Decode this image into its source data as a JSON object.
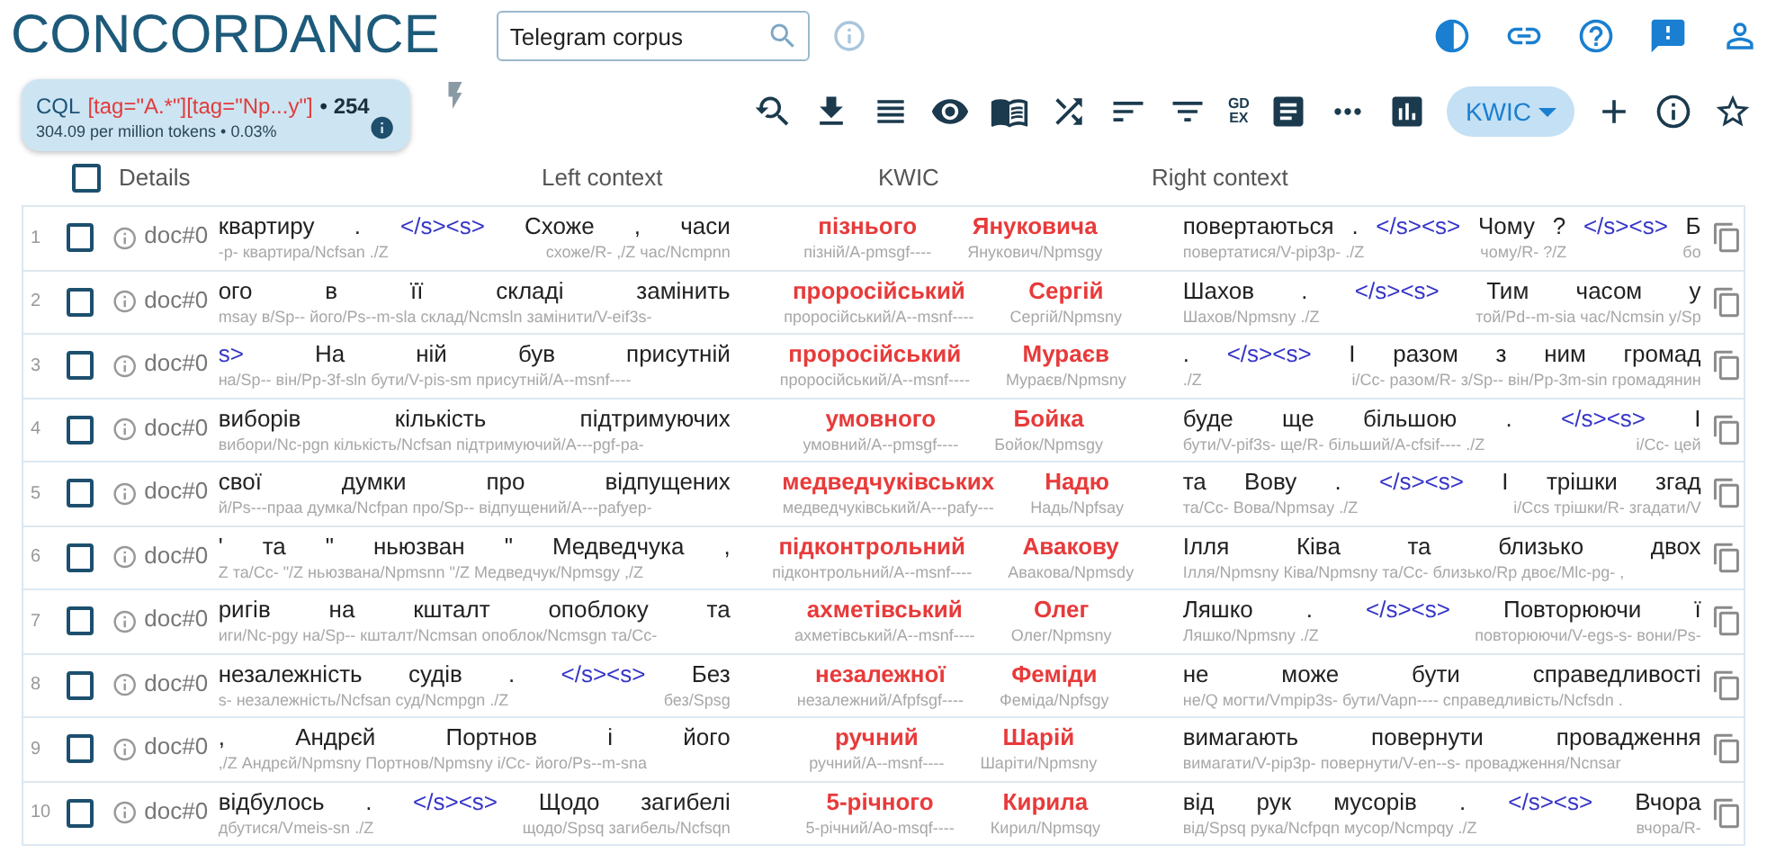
{
  "app_title": "CONCORDANCE",
  "search": {
    "value": "Telegram corpus"
  },
  "query": {
    "label": "CQL",
    "expression": "[tag=\"A.*\"][tag=\"Np...y\"]",
    "count": "• 254",
    "stats": "304.09 per million tokens • 0.03%"
  },
  "toolbar": {
    "gdex": [
      "GD",
      "EX"
    ],
    "view_mode": "KWIC"
  },
  "table": {
    "select_all": {
      "checked": false
    },
    "columns": [
      "Details",
      "Left context",
      "KWIC",
      "Right context"
    ],
    "rows": [
      {
        "number": "1",
        "checked": false,
        "doc": "doc#0",
        "left": {
          "tokens": [
            {
              "kind": "word",
              "text": "квартиру"
            },
            {
              "kind": "word",
              "text": "."
            },
            {
              "kind": "boundary",
              "text": "</s><s>"
            },
            {
              "kind": "word",
              "text": "Схоже"
            },
            {
              "kind": "word",
              "text": ","
            },
            {
              "kind": "word",
              "text": "часи"
            }
          ],
          "tags": [
            "-p- квартира/Ncfsan ./Z",
            "схоже/R- ,/Z час/Ncmpnn"
          ]
        },
        "kwic": [
          {
            "text": "пізнього",
            "tag": "пізній/A-pmsgf----"
          },
          {
            "text": "Януковича",
            "tag": "Янукович/Npmsgy"
          }
        ],
        "right": {
          "tokens": [
            {
              "kind": "word",
              "text": "повертаються"
            },
            {
              "kind": "word",
              "text": "."
            },
            {
              "kind": "boundary",
              "text": "</s><s>"
            },
            {
              "kind": "word",
              "text": "Чому"
            },
            {
              "kind": "word",
              "text": "?"
            },
            {
              "kind": "boundary",
              "text": "</s><s>"
            },
            {
              "kind": "word",
              "text": "Б"
            }
          ],
          "tags": [
            "повертатися/V-pip3p- ./Z",
            "чому/R- ?/Z",
            "бо"
          ]
        }
      },
      {
        "number": "2",
        "checked": false,
        "doc": "doc#0",
        "left": {
          "tokens": [
            {
              "kind": "word",
              "text": "ого"
            },
            {
              "kind": "word",
              "text": "в"
            },
            {
              "kind": "word",
              "text": "її"
            },
            {
              "kind": "word",
              "text": "складі"
            },
            {
              "kind": "word",
              "text": "замінить"
            }
          ],
          "tags": [
            "msay в/Sp-- його/Ps--m-sla склад/Ncmsln замінити/V-eif3s-"
          ]
        },
        "kwic": [
          {
            "text": "проросійський",
            "tag": "проросійський/A--msnf----"
          },
          {
            "text": "Сергій",
            "tag": "Сергій/Npmsny"
          }
        ],
        "right": {
          "tokens": [
            {
              "kind": "word",
              "text": "Шахов"
            },
            {
              "kind": "word",
              "text": "."
            },
            {
              "kind": "boundary",
              "text": "</s><s>"
            },
            {
              "kind": "word",
              "text": "Тим"
            },
            {
              "kind": "word",
              "text": "часом"
            },
            {
              "kind": "word",
              "text": "у"
            }
          ],
          "tags": [
            "Шахов/Npmsny ./Z",
            "той/Pd--m-sia час/Ncmsin у/Sp"
          ]
        }
      },
      {
        "number": "3",
        "checked": false,
        "doc": "doc#0",
        "left": {
          "tokens": [
            {
              "kind": "boundary",
              "text": "s>"
            },
            {
              "kind": "word",
              "text": "На"
            },
            {
              "kind": "word",
              "text": "ній"
            },
            {
              "kind": "word",
              "text": "був"
            },
            {
              "kind": "word",
              "text": "присутній"
            }
          ],
          "tags": [
            "на/Sp-- він/Pp-3f-sln бути/V-pis-sm присутній/A--msnf----"
          ]
        },
        "kwic": [
          {
            "text": "проросійський",
            "tag": "проросійський/A--msnf----"
          },
          {
            "text": "Мураєв",
            "tag": "Мураєв/Npmsny"
          }
        ],
        "right": {
          "tokens": [
            {
              "kind": "word",
              "text": "."
            },
            {
              "kind": "boundary",
              "text": "</s><s>"
            },
            {
              "kind": "word",
              "text": "І"
            },
            {
              "kind": "word",
              "text": "разом"
            },
            {
              "kind": "word",
              "text": "з"
            },
            {
              "kind": "word",
              "text": "ним"
            },
            {
              "kind": "word",
              "text": "громад"
            }
          ],
          "tags": [
            "./Z",
            "і/Cc- разом/R- з/Sp-- він/Pp-3m-sin громадянин"
          ]
        }
      },
      {
        "number": "4",
        "checked": false,
        "doc": "doc#0",
        "left": {
          "tokens": [
            {
              "kind": "word",
              "text": "виборів"
            },
            {
              "kind": "word",
              "text": "кількість"
            },
            {
              "kind": "word",
              "text": "підтримуючих"
            }
          ],
          "tags": [
            "вибори/Nc-pgn кількість/Ncfsan підтримуючий/A---pgf-pa-"
          ]
        },
        "kwic": [
          {
            "text": "умовного",
            "tag": "умовний/A--pmsgf----"
          },
          {
            "text": "Бойка",
            "tag": "Бойок/Npmsgy"
          }
        ],
        "right": {
          "tokens": [
            {
              "kind": "word",
              "text": "буде"
            },
            {
              "kind": "word",
              "text": "ще"
            },
            {
              "kind": "word",
              "text": "більшою"
            },
            {
              "kind": "word",
              "text": "."
            },
            {
              "kind": "boundary",
              "text": "</s><s>"
            },
            {
              "kind": "word",
              "text": "І"
            }
          ],
          "tags": [
            "бути/V-pif3s- ще/R- більший/A-cfsif---- ./Z",
            "і/Cc- цей"
          ]
        }
      },
      {
        "number": "5",
        "checked": false,
        "doc": "doc#0",
        "left": {
          "tokens": [
            {
              "kind": "word",
              "text": "свої"
            },
            {
              "kind": "word",
              "text": "думки"
            },
            {
              "kind": "word",
              "text": "про"
            },
            {
              "kind": "word",
              "text": "відпущених"
            }
          ],
          "tags": [
            "й/Ps---праа думка/Ncfpan про/Sp-- відпущений/A---pafyep-"
          ]
        },
        "kwic": [
          {
            "text": "медведчуківських",
            "tag": "медведчуківський/A---pafy---"
          },
          {
            "text": "Надю",
            "tag": "Надь/Npfsay"
          }
        ],
        "right": {
          "tokens": [
            {
              "kind": "word",
              "text": "та"
            },
            {
              "kind": "word",
              "text": "Вову"
            },
            {
              "kind": "word",
              "text": "."
            },
            {
              "kind": "boundary",
              "text": "</s><s>"
            },
            {
              "kind": "word",
              "text": "І"
            },
            {
              "kind": "word",
              "text": "трішки"
            },
            {
              "kind": "word",
              "text": "згад"
            }
          ],
          "tags": [
            "та/Cc- Вова/Npmsay ./Z",
            "і/Ccs трішки/R- згадати/V"
          ]
        }
      },
      {
        "number": "6",
        "checked": false,
        "doc": "doc#0",
        "left": {
          "tokens": [
            {
              "kind": "word",
              "text": "'"
            },
            {
              "kind": "word",
              "text": "та"
            },
            {
              "kind": "word",
              "text": "\""
            },
            {
              "kind": "word",
              "text": "ньюзван"
            },
            {
              "kind": "word",
              "text": "\""
            },
            {
              "kind": "word",
              "text": "Медведчука"
            },
            {
              "kind": "word",
              "text": ","
            }
          ],
          "tags": [
            "Z та/Cc- \"/Z ньюзвана/Npmsnn \"/Z Медведчук/Npmsgy ,/Z"
          ]
        },
        "kwic": [
          {
            "text": "підконтрольний",
            "tag": "підконтрольний/A--msnf----"
          },
          {
            "text": "Авакову",
            "tag": "Авакова/Npmsdy"
          }
        ],
        "right": {
          "tokens": [
            {
              "kind": "word",
              "text": "Ілля"
            },
            {
              "kind": "word",
              "text": "Ківа"
            },
            {
              "kind": "word",
              "text": "та"
            },
            {
              "kind": "word",
              "text": "близько"
            },
            {
              "kind": "word",
              "text": "двох"
            }
          ],
          "tags": [
            "Ілля/Npmsny Ківа/Npmsny та/Cc- близько/Rp двоє/Mlc-pg- ,"
          ]
        }
      },
      {
        "number": "7",
        "checked": false,
        "doc": "doc#0",
        "left": {
          "tokens": [
            {
              "kind": "word",
              "text": "ригів"
            },
            {
              "kind": "word",
              "text": "на"
            },
            {
              "kind": "word",
              "text": "кшталт"
            },
            {
              "kind": "word",
              "text": "опоблоку"
            },
            {
              "kind": "word",
              "text": "та"
            }
          ],
          "tags": [
            "иги/Nc-pgy на/Sp-- кшталт/Ncmsan опоблок/Ncmsgn та/Cc-"
          ]
        },
        "kwic": [
          {
            "text": "ахметівський",
            "tag": "ахметівський/A--msnf----"
          },
          {
            "text": "Олег",
            "tag": "Олег/Npmsny"
          }
        ],
        "right": {
          "tokens": [
            {
              "kind": "word",
              "text": "Ляшко"
            },
            {
              "kind": "word",
              "text": "."
            },
            {
              "kind": "boundary",
              "text": "</s><s>"
            },
            {
              "kind": "word",
              "text": "Повторюючи"
            },
            {
              "kind": "word",
              "text": "ї"
            }
          ],
          "tags": [
            "Ляшко/Npmsny ./Z",
            "повторюючи/V-egs-s- вони/Ps-"
          ]
        }
      },
      {
        "number": "8",
        "checked": false,
        "doc": "doc#0",
        "left": {
          "tokens": [
            {
              "kind": "word",
              "text": "незалежність"
            },
            {
              "kind": "word",
              "text": "судів"
            },
            {
              "kind": "word",
              "text": "."
            },
            {
              "kind": "boundary",
              "text": "</s><s>"
            },
            {
              "kind": "word",
              "text": "Без"
            }
          ],
          "tags": [
            "s- незалежність/Ncfsan суд/Ncmpgn ./Z",
            "без/Spsg"
          ]
        },
        "kwic": [
          {
            "text": "незалежної",
            "tag": "незалежний/Afpfsgf----"
          },
          {
            "text": "Феміди",
            "tag": "Феміда/Npfsgy"
          }
        ],
        "right": {
          "tokens": [
            {
              "kind": "word",
              "text": "не"
            },
            {
              "kind": "word",
              "text": "може"
            },
            {
              "kind": "word",
              "text": "бути"
            },
            {
              "kind": "word",
              "text": "справедливості"
            }
          ],
          "tags": [
            "не/Q могти/Vmpip3s- бути/Vapn---- справедливість/Ncfsdn ."
          ]
        }
      },
      {
        "number": "9",
        "checked": false,
        "doc": "doc#0",
        "left": {
          "tokens": [
            {
              "kind": "word",
              "text": ","
            },
            {
              "kind": "word",
              "text": "Андрєй"
            },
            {
              "kind": "word",
              "text": "Портнов"
            },
            {
              "kind": "word",
              "text": "і"
            },
            {
              "kind": "word",
              "text": "його"
            }
          ],
          "tags": [
            ",/Z Андрєй/Npmsny Портнов/Npmsny і/Cc- його/Ps--m-sna"
          ]
        },
        "kwic": [
          {
            "text": "ручний",
            "tag": "ручний/A--msnf----"
          },
          {
            "text": "Шарій",
            "tag": "Шаріти/Npmsny"
          }
        ],
        "right": {
          "tokens": [
            {
              "kind": "word",
              "text": "вимагають"
            },
            {
              "kind": "word",
              "text": "повернути"
            },
            {
              "kind": "word",
              "text": "провадження"
            }
          ],
          "tags": [
            "вимагати/V-pip3p- повернути/V-en--s- провадження/Ncnsar"
          ]
        }
      },
      {
        "number": "10",
        "checked": false,
        "doc": "doc#0",
        "left": {
          "tokens": [
            {
              "kind": "word",
              "text": "відбулось"
            },
            {
              "kind": "word",
              "text": "."
            },
            {
              "kind": "boundary",
              "text": "</s><s>"
            },
            {
              "kind": "word",
              "text": "Щодо"
            },
            {
              "kind": "word",
              "text": "загибелі"
            }
          ],
          "tags": [
            "дбутися/Vmeis-sn ./Z",
            "щодо/Spsq загибель/Ncfsqn"
          ]
        },
        "kwic": [
          {
            "text": "5-річного",
            "tag": "5-річний/Ao-msqf----"
          },
          {
            "text": "Кирила",
            "tag": "Кирил/Npmsqy"
          }
        ],
        "right": {
          "tokens": [
            {
              "kind": "word",
              "text": "від"
            },
            {
              "kind": "word",
              "text": "рук"
            },
            {
              "kind": "word",
              "text": "мусорів"
            },
            {
              "kind": "word",
              "text": "."
            },
            {
              "kind": "boundary",
              "text": "</s><s>"
            },
            {
              "kind": "word",
              "text": "Вчора"
            }
          ],
          "tags": [
            "від/Spsq рука/Ncfpqn мусор/Ncmpqy ./Z",
            "вчора/R-"
          ]
        }
      }
    ]
  }
}
